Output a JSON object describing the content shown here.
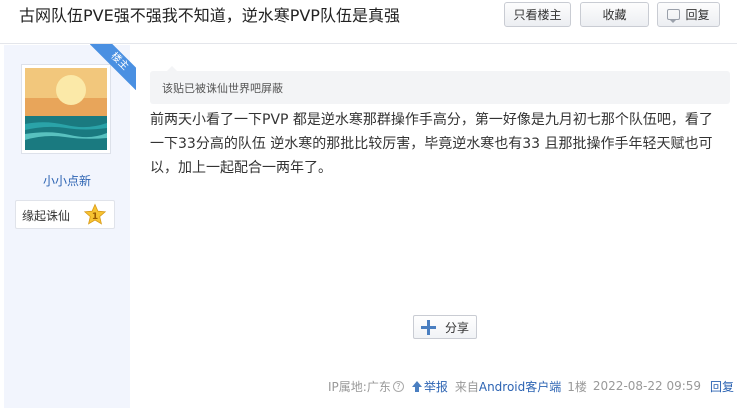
{
  "post": {
    "title": "古网队伍PVE强不强我不知道，逆水寒PVP队伍是真强",
    "buttons": {
      "only_owner": "只看楼主",
      "favorite": "收藏",
      "reply": "回复"
    }
  },
  "author": {
    "ribbon": "楼主",
    "username": "小小点新",
    "badge_name": "缘起诛仙",
    "badge_level": "1"
  },
  "content": {
    "notice": "该贴已被诛仙世界吧屏蔽",
    "lines": [
      "前两天小看了一下PVP 都是逆水寒那群操作手高分，第一好像是九月初七那个队伍吧，看了",
      "一下33分高的队伍 逆水寒的那批比较厉害，毕竟逆水寒也有33 且那批操作手年轻天赋也可",
      "以，加上一起配合一两年了。"
    ],
    "share_label": "分享"
  },
  "footer": {
    "ip_location": "IP属地:广东",
    "help_glyph": "?",
    "report": "举报",
    "source_prefix": "来自",
    "source_link": "Android客户端",
    "floor": "1楼",
    "time": "2022-08-22 09:59",
    "reply": "回复"
  },
  "icons": {
    "reply": "speech-bubble-icon",
    "share": "plus-icon",
    "report": "warning-icon",
    "help": "question-circle-icon",
    "badge": "star-icon"
  },
  "colors": {
    "link": "#2d64b3",
    "ribbon": "#4a90e2",
    "sidebar": "#f2f5fd"
  }
}
